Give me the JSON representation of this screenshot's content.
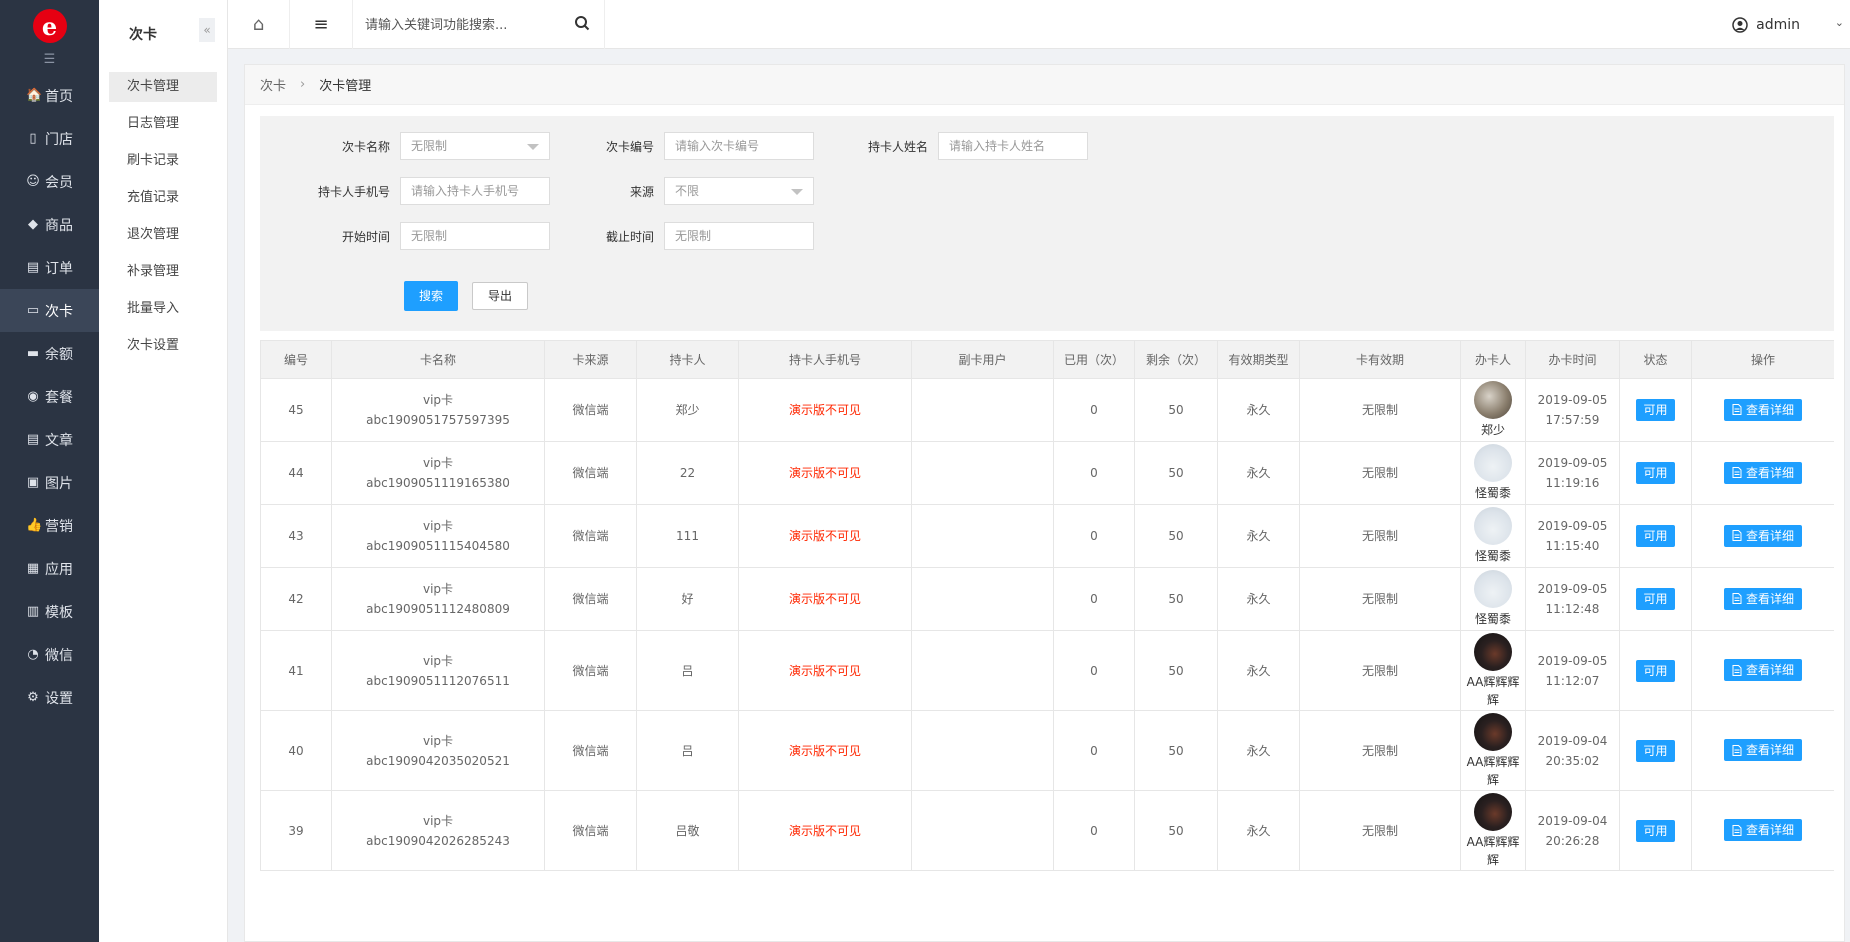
{
  "logo": {
    "letter": "e"
  },
  "leftnav": {
    "toggle": "☰",
    "items": [
      {
        "label": "首页",
        "icon": "🏠"
      },
      {
        "label": "门店",
        "icon": "▯"
      },
      {
        "label": "会员",
        "icon": "☺"
      },
      {
        "label": "商品",
        "icon": "◆"
      },
      {
        "label": "订单",
        "icon": "▤"
      },
      {
        "label": "次卡",
        "icon": "▭"
      },
      {
        "label": "余额",
        "icon": "▬"
      },
      {
        "label": "套餐",
        "icon": "◉"
      },
      {
        "label": "文章",
        "icon": "▤"
      },
      {
        "label": "图片",
        "icon": "▣"
      },
      {
        "label": "营销",
        "icon": "👍"
      },
      {
        "label": "应用",
        "icon": "▦"
      },
      {
        "label": "模板",
        "icon": "▥"
      },
      {
        "label": "微信",
        "icon": "◔"
      },
      {
        "label": "设置",
        "icon": "⚙"
      }
    ]
  },
  "subnav": {
    "title": "次卡",
    "collapse": "«",
    "items": [
      {
        "label": "次卡管理"
      },
      {
        "label": "日志管理"
      },
      {
        "label": "刷卡记录"
      },
      {
        "label": "充值记录"
      },
      {
        "label": "退次管理"
      },
      {
        "label": "补录管理"
      },
      {
        "label": "批量导入"
      },
      {
        "label": "次卡设置"
      }
    ]
  },
  "topbar": {
    "home_icon": "⌂",
    "menu_icon": "≡",
    "search_placeholder": "请输入关键词功能搜索...",
    "user": "admin",
    "caret": "⌄"
  },
  "breadcrumb": {
    "parent": "次卡",
    "sep": "›",
    "current": "次卡管理"
  },
  "filter": {
    "card_name": {
      "label": "次卡名称",
      "value": "无限制"
    },
    "card_no": {
      "label": "次卡编号",
      "placeholder": "请输入次卡编号"
    },
    "holder_name": {
      "label": "持卡人姓名",
      "placeholder": "请输入持卡人姓名"
    },
    "holder_phone": {
      "label": "持卡人手机号",
      "placeholder": "请输入持卡人手机号"
    },
    "source": {
      "label": "来源",
      "value": "不限"
    },
    "start_time": {
      "label": "开始时间",
      "placeholder": "无限制"
    },
    "end_time": {
      "label": "截止时间",
      "placeholder": "无限制"
    },
    "search_btn": "搜索",
    "export_btn": "导出"
  },
  "table": {
    "headers": [
      "编号",
      "卡名称",
      "卡来源",
      "持卡人",
      "持卡人手机号",
      "副卡用户",
      "已用（次）",
      "剩余（次）",
      "有效期类型",
      "卡有效期",
      "办卡人",
      "办卡时间",
      "状态",
      "操作"
    ],
    "rows": [
      {
        "id": "45",
        "name1": "vip卡",
        "name2": "abc1909051757597395",
        "source": "微信端",
        "holder": "郑少",
        "phone": "演示版不可见",
        "sub": "",
        "used": "0",
        "left": "50",
        "vtype": "永久",
        "valid": "无限制",
        "agent": "郑少",
        "avatar": "a",
        "date": "2019-09-05",
        "time": "17:57:59",
        "status": "可用",
        "action": "查看详细"
      },
      {
        "id": "44",
        "name1": "vip卡",
        "name2": "abc1909051119165380",
        "source": "微信端",
        "holder": "22",
        "phone": "演示版不可见",
        "sub": "",
        "used": "0",
        "left": "50",
        "vtype": "永久",
        "valid": "无限制",
        "agent": "怪蜀黍",
        "avatar": "b",
        "date": "2019-09-05",
        "time": "11:19:16",
        "status": "可用",
        "action": "查看详细"
      },
      {
        "id": "43",
        "name1": "vip卡",
        "name2": "abc1909051115404580",
        "source": "微信端",
        "holder": "111",
        "phone": "演示版不可见",
        "sub": "",
        "used": "0",
        "left": "50",
        "vtype": "永久",
        "valid": "无限制",
        "agent": "怪蜀黍",
        "avatar": "b",
        "date": "2019-09-05",
        "time": "11:15:40",
        "status": "可用",
        "action": "查看详细"
      },
      {
        "id": "42",
        "name1": "vip卡",
        "name2": "abc1909051112480809",
        "source": "微信端",
        "holder": "好",
        "phone": "演示版不可见",
        "sub": "",
        "used": "0",
        "left": "50",
        "vtype": "永久",
        "valid": "无限制",
        "agent": "怪蜀黍",
        "avatar": "b",
        "date": "2019-09-05",
        "time": "11:12:48",
        "status": "可用",
        "action": "查看详细"
      },
      {
        "id": "41",
        "name1": "vip卡",
        "name2": "abc1909051112076511",
        "source": "微信端",
        "holder": "吕",
        "phone": "演示版不可见",
        "sub": "",
        "used": "0",
        "left": "50",
        "vtype": "永久",
        "valid": "无限制",
        "agent": "AA辉辉辉辉",
        "avatar": "c",
        "date": "2019-09-05",
        "time": "11:12:07",
        "status": "可用",
        "action": "查看详细"
      },
      {
        "id": "40",
        "name1": "vip卡",
        "name2": "abc1909042035020521",
        "source": "微信端",
        "holder": "吕",
        "phone": "演示版不可见",
        "sub": "",
        "used": "0",
        "left": "50",
        "vtype": "永久",
        "valid": "无限制",
        "agent": "AA辉辉辉辉",
        "avatar": "c",
        "date": "2019-09-04",
        "time": "20:35:02",
        "status": "可用",
        "action": "查看详细"
      },
      {
        "id": "39",
        "name1": "vip卡",
        "name2": "abc1909042026285243",
        "source": "微信端",
        "holder": "吕敬",
        "phone": "演示版不可见",
        "sub": "",
        "used": "0",
        "left": "50",
        "vtype": "永久",
        "valid": "无限制",
        "agent": "AA辉辉辉辉",
        "avatar": "c",
        "date": "2019-09-04",
        "time": "20:26:28",
        "status": "可用",
        "action": "查看详细"
      }
    ]
  },
  "colors": {
    "nav_bg": "#2b3443",
    "accent": "#1e9fff",
    "danger_text": "#ff2600",
    "logo_red": "#e60012"
  }
}
